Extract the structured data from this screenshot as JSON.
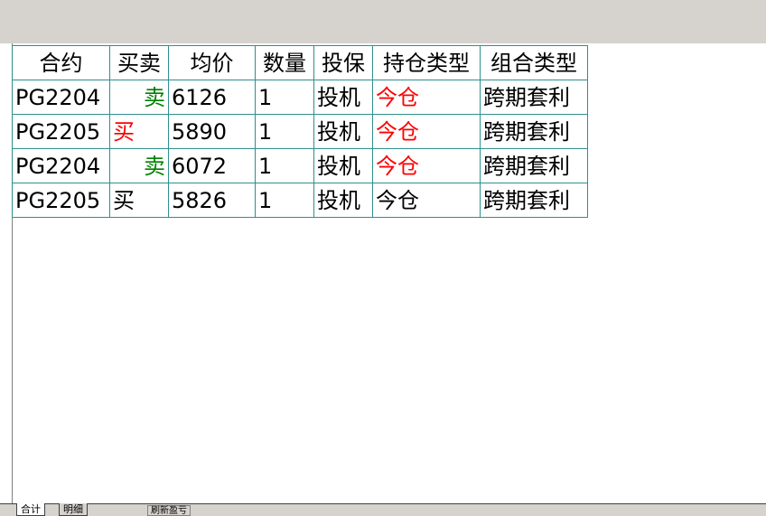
{
  "colors": {
    "buy": "#ff0000",
    "sell": "#008000",
    "today_position": "#ff0000",
    "grid_border": "#2f8f8f"
  },
  "table": {
    "headers": [
      "合约",
      "买卖",
      "均价",
      "数量",
      "投保",
      "持仓类型",
      "组合类型"
    ],
    "rows": [
      {
        "contract": "PG2204",
        "side": "卖",
        "side_type": "sell",
        "price": "6126",
        "qty": "1",
        "hedge": "投机",
        "pos_type": "今仓",
        "pos_colored": true,
        "combo": "跨期套利"
      },
      {
        "contract": "PG2205",
        "side": "买",
        "side_type": "buy",
        "price": "5890",
        "qty": "1",
        "hedge": "投机",
        "pos_type": "今仓",
        "pos_colored": true,
        "combo": "跨期套利"
      },
      {
        "contract": "PG2204",
        "side": "卖",
        "side_type": "sell",
        "price": "6072",
        "qty": "1",
        "hedge": "投机",
        "pos_type": "今仓",
        "pos_colored": true,
        "combo": "跨期套利"
      },
      {
        "contract": "PG2205",
        "side": "买",
        "side_type": "buy_plain",
        "price": "5826",
        "qty": "1",
        "hedge": "投机",
        "pos_type": "今仓",
        "pos_colored": false,
        "combo": "跨期套利"
      }
    ]
  },
  "tabs": {
    "total": "合计",
    "detail": "明细",
    "refresh": "刷新盈亏"
  }
}
